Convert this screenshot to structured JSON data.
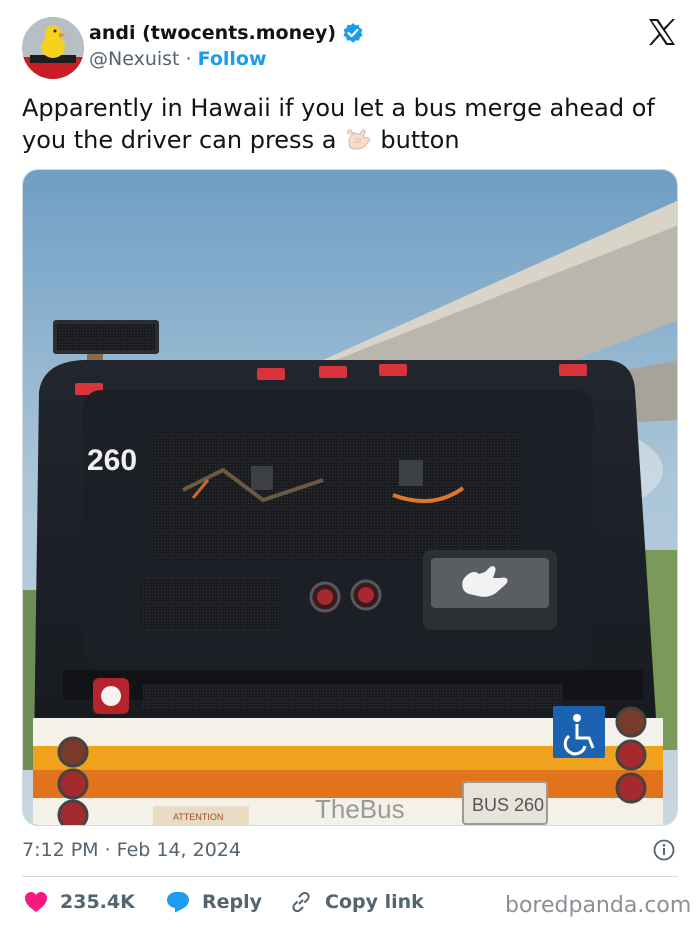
{
  "author": {
    "display_name": "andi (twocents.money)",
    "handle": "@Nexuist",
    "separator": "·",
    "follow_label": "Follow"
  },
  "tweet": {
    "text_before": "Apparently in Hawaii if you let a bus merge ahead of you the driver can press a",
    "emoji": "shaka-hand-emoji",
    "text_after": "button"
  },
  "media": {
    "bus_number": "260",
    "plate_text": "BUS 260",
    "brand_text": "TheBus",
    "sign_text": "ATTENTION"
  },
  "timestamp": "7:12 PM · Feb 14, 2024",
  "actions": {
    "likes": "235.4K",
    "reply_label": "Reply",
    "copy_label": "Copy link"
  },
  "watermark": "boredpanda.com",
  "colors": {
    "like": "#f91880",
    "reply": "#1d9bf0",
    "link": "#1d9bf0",
    "verified": "#1d9bf0",
    "muted": "#536471"
  },
  "icons": [
    "verified-badge-icon",
    "x-logo-icon",
    "info-icon",
    "heart-icon",
    "reply-bubble-icon",
    "link-icon"
  ]
}
